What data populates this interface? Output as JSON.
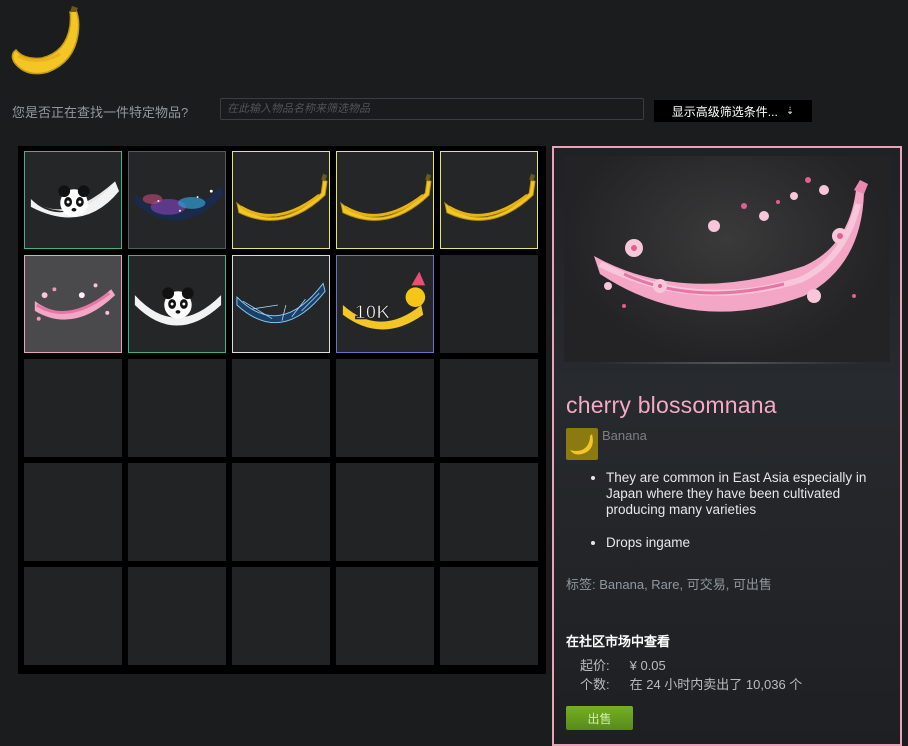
{
  "filter": {
    "label": "您是否正在查找一件特定物品?",
    "placeholder": "在此输入物品名称来筛选物品",
    "advanced_label": "显示高级筛选条件..."
  },
  "inventory": {
    "items": [
      {
        "name": "panda banana",
        "border": "#3fb488"
      },
      {
        "name": "galaxy banana",
        "border": "#555a5e"
      },
      {
        "name": "banana",
        "border": "#e8e372"
      },
      {
        "name": "banana",
        "border": "#e8e372"
      },
      {
        "name": "banana",
        "border": "#e8e372"
      },
      {
        "name": "cherry blossomnana",
        "border": "#e8a3b6"
      },
      {
        "name": "panda banana",
        "border": "#3fb488"
      },
      {
        "name": "blue wireframe banana",
        "border": "#dddddd"
      },
      {
        "name": "10K banana",
        "border": "#6d72c8"
      }
    ],
    "empty_slots": 16
  },
  "detail": {
    "name": "cherry blossomnana",
    "name_color": "#f5aac3",
    "game": "Banana",
    "description": [
      "They are common in East Asia especially in Japan where they have been cultivated producing many varieties",
      "Drops ingame"
    ],
    "tags_label": "标签:",
    "tags": "Banana, Rare, 可交易, 可出售",
    "market_title": "在社区市场中查看",
    "starting_label": "起价:",
    "starting_price": "¥ 0.05",
    "count_label": "个数:",
    "count_text": "在 24 小时内卖出了 10,036 个",
    "sell_label": "出售"
  },
  "badge_text": "10K"
}
